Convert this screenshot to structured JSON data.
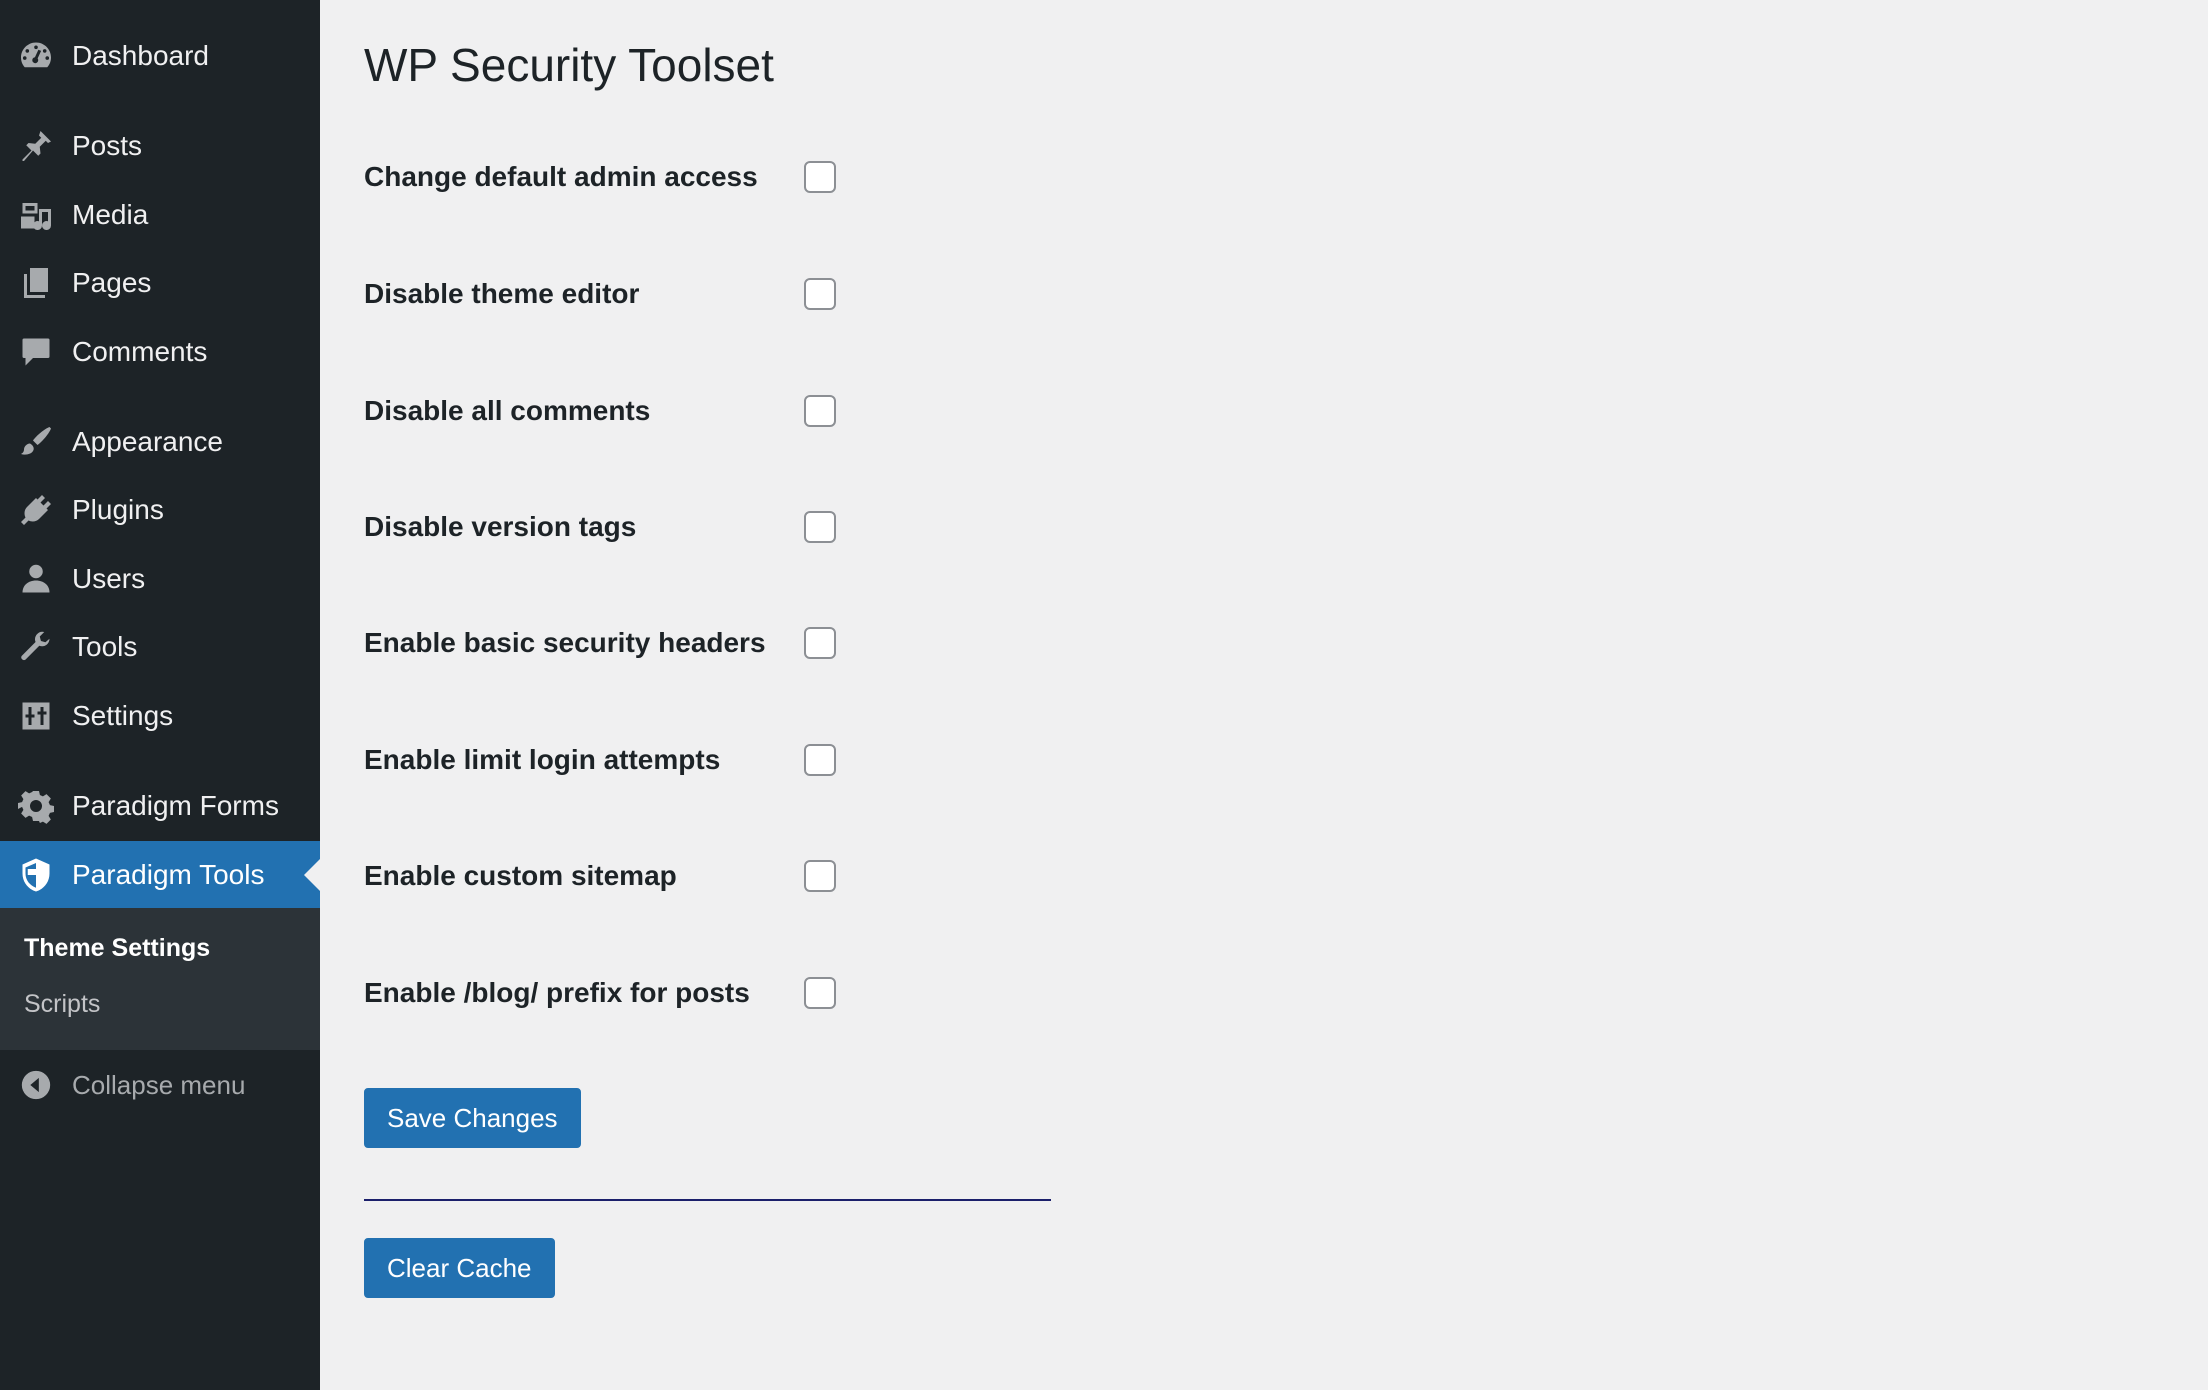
{
  "sidebar": {
    "items": [
      {
        "label": "Dashboard",
        "icon": "dashboard-icon"
      },
      {
        "label": "Posts",
        "icon": "pushpin-icon"
      },
      {
        "label": "Media",
        "icon": "media-icon"
      },
      {
        "label": "Pages",
        "icon": "pages-icon"
      },
      {
        "label": "Comments",
        "icon": "comment-icon"
      },
      {
        "label": "Appearance",
        "icon": "paintbrush-icon"
      },
      {
        "label": "Plugins",
        "icon": "plug-icon"
      },
      {
        "label": "Users",
        "icon": "user-icon"
      },
      {
        "label": "Tools",
        "icon": "wrench-icon"
      },
      {
        "label": "Settings",
        "icon": "settings-sliders-icon"
      },
      {
        "label": "Paradigm Forms",
        "icon": "gear-icon"
      },
      {
        "label": "Paradigm Tools",
        "icon": "shield-icon",
        "current": true
      }
    ],
    "submenu": [
      {
        "label": "Theme Settings",
        "current": true
      },
      {
        "label": "Scripts"
      }
    ],
    "collapse_label": "Collapse menu"
  },
  "main": {
    "title": "WP Security Toolset",
    "options": [
      {
        "label": "Change default admin access",
        "checked": false
      },
      {
        "label": "Disable theme editor",
        "checked": false
      },
      {
        "label": "Disable all comments",
        "checked": false
      },
      {
        "label": "Disable version tags",
        "checked": false
      },
      {
        "label": "Enable basic security headers",
        "checked": false
      },
      {
        "label": "Enable limit login attempts",
        "checked": false
      },
      {
        "label": "Enable custom sitemap",
        "checked": false
      },
      {
        "label": "Enable /blog/ prefix for posts",
        "checked": false
      }
    ],
    "save_label": "Save Changes",
    "clear_cache_label": "Clear Cache"
  },
  "colors": {
    "sidebar_bg": "#1d2327",
    "accent": "#2271b1",
    "page_bg": "#f0f0f1",
    "divider": "#1b1f6b"
  }
}
